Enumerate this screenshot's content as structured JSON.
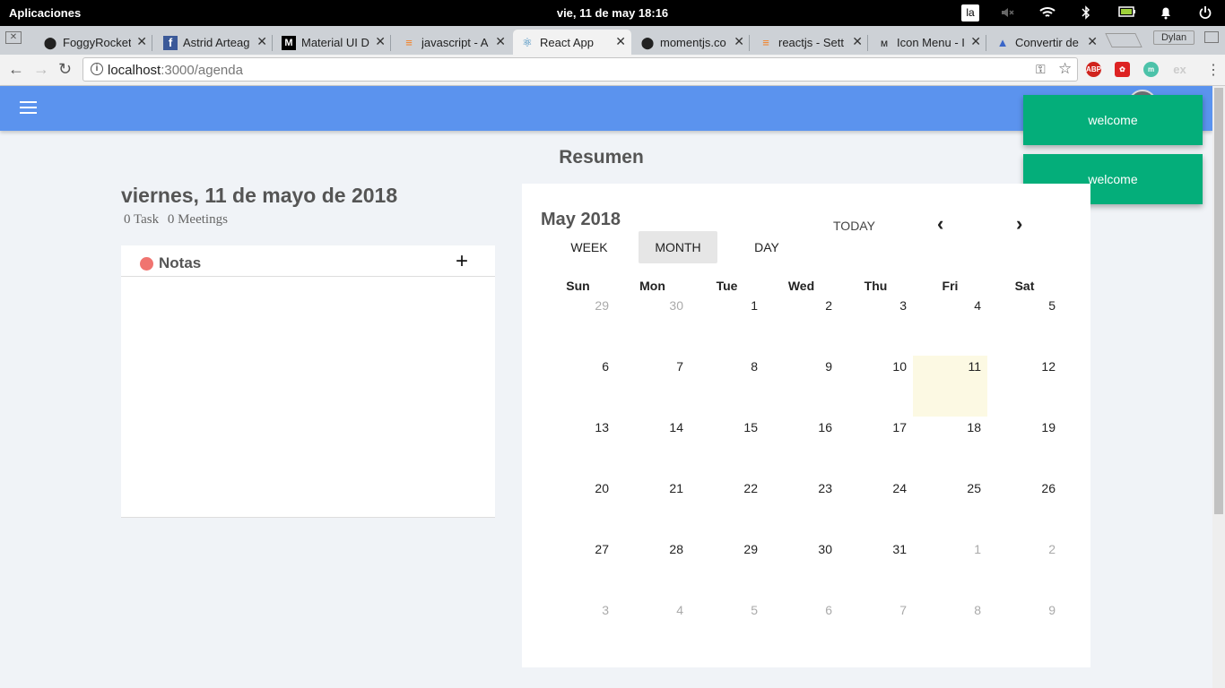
{
  "os": {
    "apps_label": "Aplicaciones",
    "clock": "vie, 11 de may    18:16",
    "lang": "la"
  },
  "browser": {
    "tabs": [
      {
        "label": "FoggyRocket",
        "icon": "github-icon"
      },
      {
        "label": "Astrid Arteag",
        "icon": "facebook-icon"
      },
      {
        "label": "Material UI D",
        "icon": "medium-icon"
      },
      {
        "label": "javascript - A",
        "icon": "stackoverflow-icon"
      },
      {
        "label": "React App",
        "icon": "react-icon"
      },
      {
        "label": "momentjs.co",
        "icon": "github-icon"
      },
      {
        "label": "reactjs - Sett",
        "icon": "stackoverflow-icon"
      },
      {
        "label": "Icon Menu - I",
        "icon": "material-icon"
      },
      {
        "label": "Convertir de",
        "icon": "converter-icon"
      }
    ],
    "profile_name": "Dylan",
    "url_host": "localhost",
    "url_path": ":3000/agenda"
  },
  "toasts": [
    "welcome",
    "welcome"
  ],
  "page": {
    "title": "Resumen",
    "date_title": "viernes, 11 de mayo de 2018",
    "task_count": "0 Task",
    "meeting_count": "0 Meetings"
  },
  "notes": {
    "title": "Notas",
    "add_label": "+"
  },
  "calendar": {
    "month_label": "May 2018",
    "today_label": "TODAY",
    "prev_label": "‹",
    "next_label": "›",
    "views": [
      "WEEK",
      "MONTH",
      "DAY"
    ],
    "selected_view": "MONTH",
    "weekdays": [
      "Sun",
      "Mon",
      "Tue",
      "Wed",
      "Thu",
      "Fri",
      "Sat"
    ],
    "weeks": [
      [
        {
          "d": "29",
          "other": true
        },
        {
          "d": "30",
          "other": true
        },
        {
          "d": "1"
        },
        {
          "d": "2"
        },
        {
          "d": "3"
        },
        {
          "d": "4"
        },
        {
          "d": "5"
        }
      ],
      [
        {
          "d": "6"
        },
        {
          "d": "7"
        },
        {
          "d": "8"
        },
        {
          "d": "9"
        },
        {
          "d": "10"
        },
        {
          "d": "11",
          "today": true
        },
        {
          "d": "12"
        }
      ],
      [
        {
          "d": "13"
        },
        {
          "d": "14"
        },
        {
          "d": "15"
        },
        {
          "d": "16"
        },
        {
          "d": "17"
        },
        {
          "d": "18"
        },
        {
          "d": "19"
        }
      ],
      [
        {
          "d": "20"
        },
        {
          "d": "21"
        },
        {
          "d": "22"
        },
        {
          "d": "23"
        },
        {
          "d": "24"
        },
        {
          "d": "25"
        },
        {
          "d": "26"
        }
      ],
      [
        {
          "d": "27"
        },
        {
          "d": "28"
        },
        {
          "d": "29"
        },
        {
          "d": "30"
        },
        {
          "d": "31"
        },
        {
          "d": "1",
          "other": true
        },
        {
          "d": "2",
          "other": true
        }
      ],
      [
        {
          "d": "3",
          "other": true
        },
        {
          "d": "4",
          "other": true
        },
        {
          "d": "5",
          "other": true
        },
        {
          "d": "6",
          "other": true
        },
        {
          "d": "7",
          "other": true
        },
        {
          "d": "8",
          "other": true
        },
        {
          "d": "9",
          "other": true
        }
      ]
    ]
  },
  "colors": {
    "appbar": "#5b93ee",
    "toast": "#04ae7a",
    "today_cell": "#fcf9e3",
    "notes_dot": "#f07470"
  }
}
